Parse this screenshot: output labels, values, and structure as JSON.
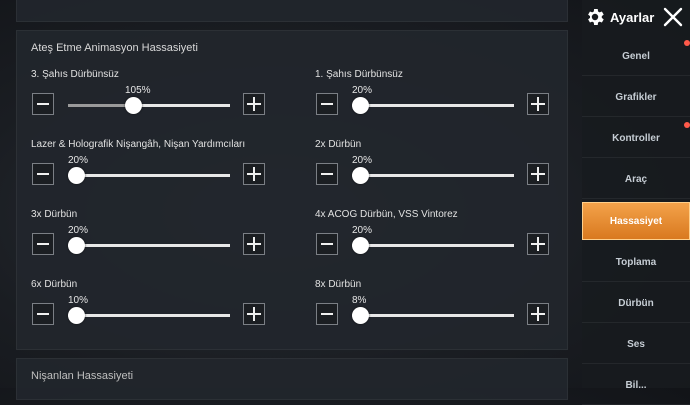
{
  "header": {
    "title": "Ayarlar",
    "settings_icon": "gear-icon",
    "close_icon": "close-icon"
  },
  "nav": {
    "items": [
      {
        "label": "Genel",
        "active": false,
        "notification": true
      },
      {
        "label": "Grafikler",
        "active": false,
        "notification": false
      },
      {
        "label": "Kontroller",
        "active": false,
        "notification": true
      },
      {
        "label": "Araç",
        "active": false,
        "notification": false
      },
      {
        "label": "Hassasiyet",
        "active": true,
        "notification": false
      },
      {
        "label": "Toplama",
        "active": false,
        "notification": false
      },
      {
        "label": "Dürbün",
        "active": false,
        "notification": false
      },
      {
        "label": "Ses",
        "active": false,
        "notification": false
      },
      {
        "label": "Bil...",
        "active": false,
        "notification": false
      }
    ]
  },
  "section": {
    "title": "Ateş Etme Animasyon Hassasiyeti",
    "controls": [
      {
        "label": "3. Şahıs Dürbünsüz",
        "value_text": "105%",
        "level": 0.35
      },
      {
        "label": "1. Şahıs Dürbünsüz",
        "value_text": "20%",
        "level": 0.0
      },
      {
        "label": "Lazer & Holografik Nişangâh, Nişan Yardımcıları",
        "value_text": "20%",
        "level": 0.0
      },
      {
        "label": "2x Dürbün",
        "value_text": "20%",
        "level": 0.0
      },
      {
        "label": "3x Dürbün",
        "value_text": "20%",
        "level": 0.0
      },
      {
        "label": "4x ACOG Dürbün, VSS Vintorez",
        "value_text": "20%",
        "level": 0.0
      },
      {
        "label": "6x Dürbün",
        "value_text": "10%",
        "level": 0.0
      },
      {
        "label": "8x Dürbün",
        "value_text": "8%",
        "level": 0.0
      }
    ]
  },
  "next_section": {
    "title": "Nişanlan Hassasiyeti"
  },
  "colors": {
    "accent": "#e88a2e",
    "notification": "#ff5a4a"
  }
}
